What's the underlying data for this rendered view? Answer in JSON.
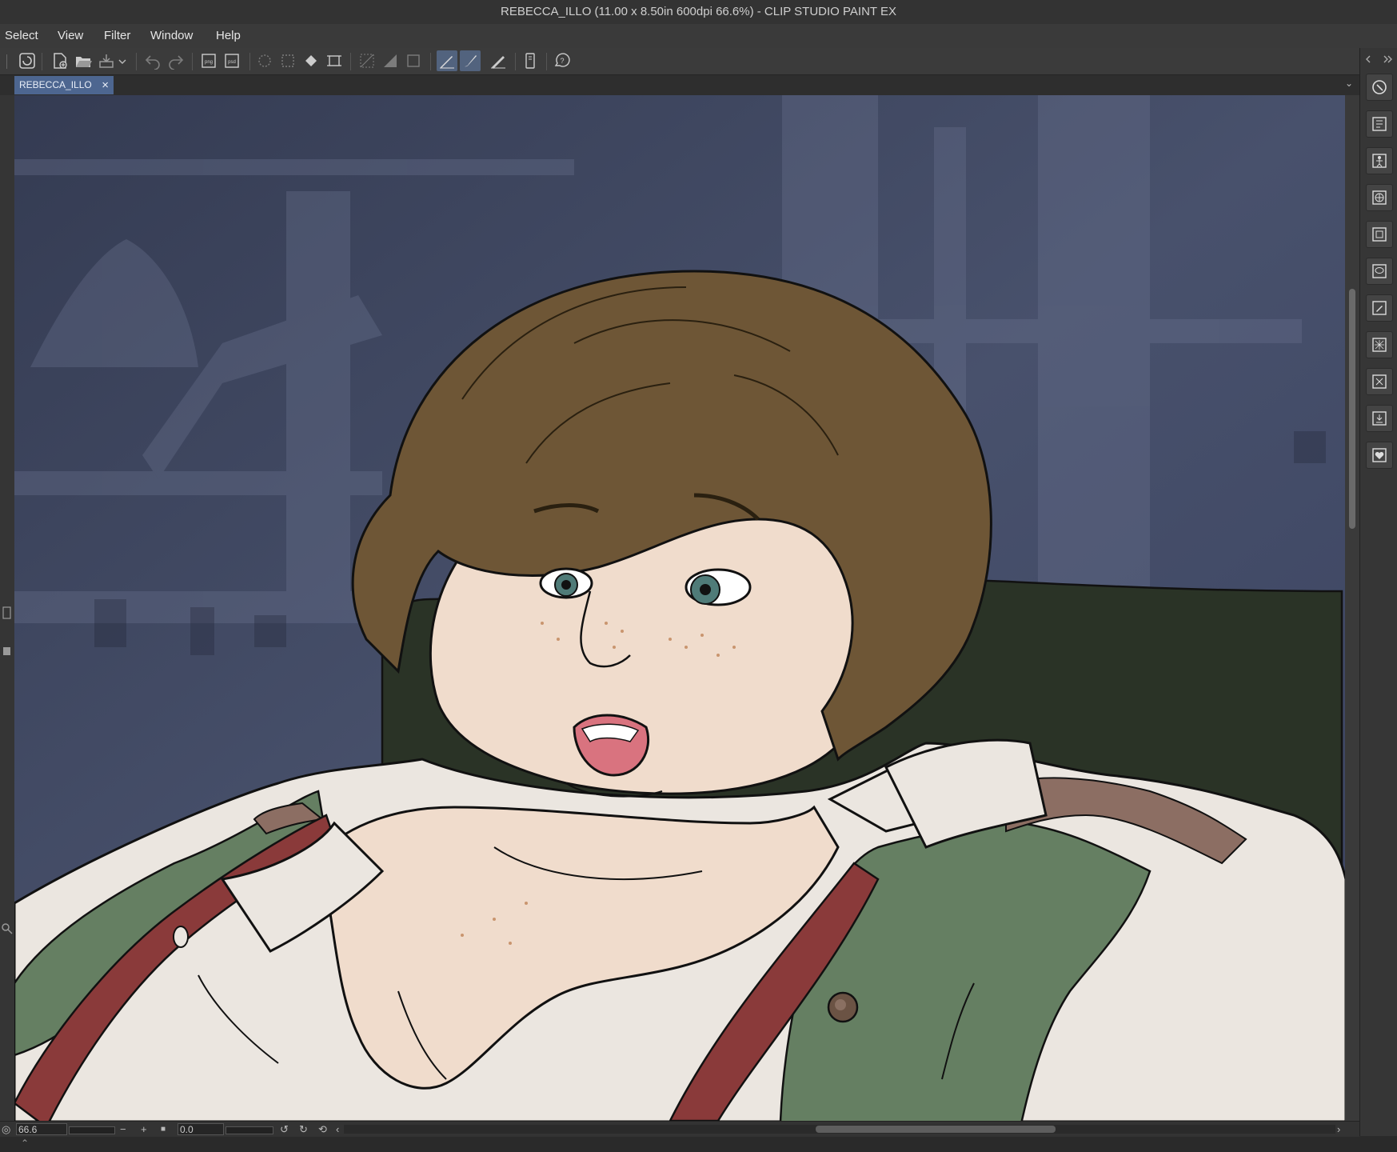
{
  "window": {
    "title": "REBECCA_ILLO (11.00 x 8.50in 600dpi 66.6%)  - CLIP STUDIO PAINT EX"
  },
  "menu": {
    "items": [
      "Select",
      "View",
      "Filter",
      "Window",
      "Help"
    ]
  },
  "toolbar": {
    "icons": [
      "clip-studio-icon",
      "new-file-icon",
      "open-file-icon",
      "save-icon",
      "save-dropdown-icon",
      "undo-icon",
      "redo-icon",
      "export-png-icon",
      "export-psd-icon",
      "clear-selection-icon",
      "select-all-icon",
      "fill-icon",
      "transform-icon",
      "invert-selection-icon",
      "hide-selection-icon",
      "show-selection-icon",
      "pen-tool-icon",
      "brush-tool-icon",
      "eraser-tool-icon",
      "tablet-icon",
      "help-icon"
    ]
  },
  "document_tab": {
    "label": "REBECCA_ILLO",
    "close": "×"
  },
  "status": {
    "zoom": "66.6",
    "rotation": "0.0",
    "zoom_out": "−",
    "zoom_in": "+"
  },
  "right_panel": {
    "icons": [
      "navigator-icon",
      "layer-property-icon",
      "3d-pose-icon",
      "material-icon",
      "layer-icon",
      "speech-balloon-icon",
      "edit-icon",
      "texture-icon",
      "layer-search-icon",
      "download-icon",
      "favorite-icon"
    ]
  },
  "colors": {
    "hair": "#6e5636",
    "skin": "#f0dccc",
    "shirt": "#ebe6e0",
    "vest": "#657f62",
    "suspenders": "#8a3a3a",
    "chair": "#2a3326",
    "background": "#3d4660",
    "active_tool": "#52637e",
    "tab": "#4d6690"
  }
}
